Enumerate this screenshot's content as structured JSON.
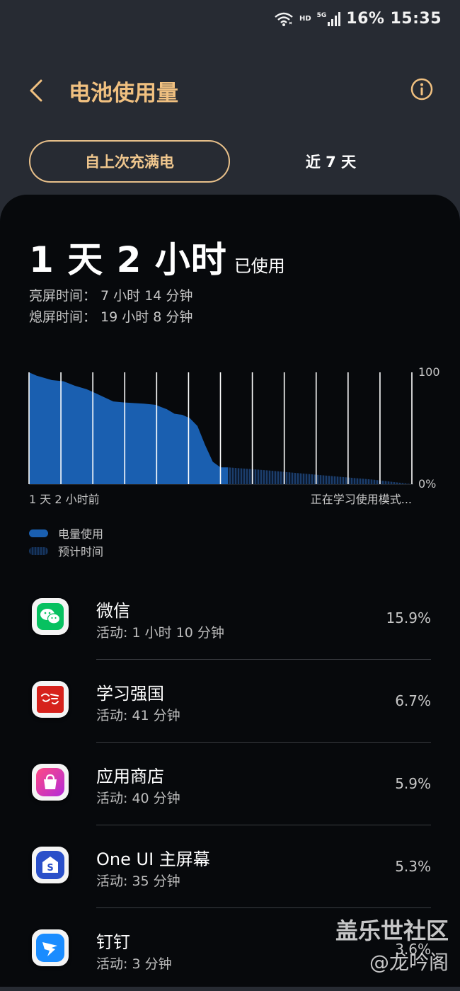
{
  "status_bar": {
    "hd": "HD",
    "network": "5G",
    "battery": "16%",
    "time": "15:35"
  },
  "header": {
    "title": "电池使用量",
    "back_icon": "back-chevron-icon",
    "info_icon": "info-icon"
  },
  "tabs": [
    {
      "label": "自上次充满电",
      "selected": true
    },
    {
      "label": "近 7 天",
      "selected": false
    }
  ],
  "usage": {
    "total": "1 天 2 小时",
    "suffix": "已使用",
    "screen_on": "亮屏时间：  7 小时 14 分钟",
    "screen_off": "熄屏时间：  19 小时 8 分钟"
  },
  "chart_data": {
    "type": "area",
    "y_labels": [
      "100",
      "0%"
    ],
    "ylim": [
      0,
      100
    ],
    "x_start_label": "1 天 2 小时前",
    "x_end_label": "正在学习使用模式...",
    "series": [
      {
        "name": "电量使用",
        "color": "#1a5fb0",
        "x": [
          0,
          0.02,
          0.04,
          0.06,
          0.09,
          0.12,
          0.15,
          0.17,
          0.22,
          0.25,
          0.3,
          0.33,
          0.36,
          0.38,
          0.4,
          0.42,
          0.44,
          0.46,
          0.48,
          0.5,
          0.52
        ],
        "values": [
          100,
          97,
          95,
          93,
          92,
          88,
          85,
          82,
          74,
          73,
          72,
          71,
          67,
          63,
          62,
          59,
          52,
          35,
          20,
          15,
          15
        ]
      },
      {
        "name": "预计时间",
        "color": "#16355e",
        "x": [
          0.52,
          0.6,
          0.7,
          0.8,
          0.9,
          1.0
        ],
        "values": [
          15,
          13,
          10,
          7,
          4,
          0
        ]
      }
    ]
  },
  "legend": [
    {
      "label": "电量使用",
      "swatch": "solid"
    },
    {
      "label": "预计时间",
      "swatch": "hatched"
    }
  ],
  "apps": [
    {
      "name": "微信",
      "activity": "活动: 1 小时 10 分钟",
      "percent": "15.9%",
      "icon": "wechat-icon",
      "color": "#07c160"
    },
    {
      "name": "学习强国",
      "activity": "活动: 41 分钟",
      "percent": "6.7%",
      "icon": "xuexi-qiangguo-icon",
      "color": "#d6221c"
    },
    {
      "name": "应用商店",
      "activity": "活动: 40 分钟",
      "percent": "5.9%",
      "icon": "galaxy-store-icon",
      "color": "#e7338f"
    },
    {
      "name": "One UI 主屏幕",
      "activity": "活动: 35 分钟",
      "percent": "5.3%",
      "icon": "one-ui-home-icon",
      "color": "#2a4fc9"
    },
    {
      "name": "钉钉",
      "activity": "活动: 3 分钟",
      "percent": "3.6%",
      "icon": "dingtalk-icon",
      "color": "#1a8cff"
    }
  ],
  "watermark": {
    "line1": "盖乐世社区",
    "line2": "@龙吟阁"
  }
}
